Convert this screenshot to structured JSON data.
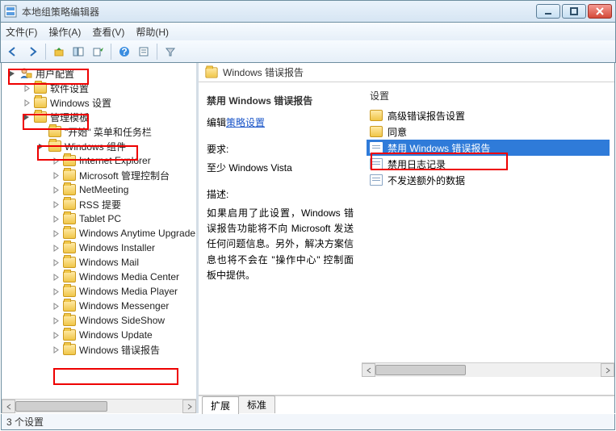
{
  "window": {
    "title": "本地组策略编辑器"
  },
  "menus": {
    "file": "文件(F)",
    "action": "操作(A)",
    "view": "查看(V)",
    "help": "帮助(H)"
  },
  "tree": {
    "root": "用户配置",
    "software": "软件设置",
    "winsettings": "Windows 设置",
    "admintpl": "管理模板",
    "startmenu": "\"开始\" 菜单和任务栏",
    "wincomp": "Windows 组件",
    "children": [
      "Internet Explorer",
      "Microsoft 管理控制台",
      "NetMeeting",
      "RSS 提要",
      "Tablet PC",
      "Windows Anytime Upgrade",
      "Windows Installer",
      "Windows Mail",
      "Windows Media Center",
      "Windows Media Player",
      "Windows Messenger",
      "Windows SideShow",
      "Windows Update",
      "Windows 错误报告"
    ]
  },
  "right": {
    "header": "Windows 错误报告",
    "selected_title": "禁用 Windows 错误报告",
    "edit_prefix": "编辑",
    "edit_link": "策略设置",
    "req_label": "要求:",
    "req_value": "至少 Windows Vista",
    "desc_label": "描述:",
    "desc_body": "如果启用了此设置，Windows 错误报告功能将不向 Microsoft 发送任何问题信息。另外，解决方案信息也将不会在 \"操作中心\" 控制面板中提供。",
    "col_setting": "设置",
    "items": [
      {
        "type": "folder",
        "label": "高级错误报告设置"
      },
      {
        "type": "folder",
        "label": "同意"
      },
      {
        "type": "doc",
        "label": "禁用 Windows 错误报告",
        "selected": true
      },
      {
        "type": "doc",
        "label": "禁用日志记录"
      },
      {
        "type": "doc",
        "label": "不发送额外的数据"
      }
    ],
    "tabs": {
      "ext": "扩展",
      "std": "标准"
    }
  },
  "status": "3 个设置"
}
